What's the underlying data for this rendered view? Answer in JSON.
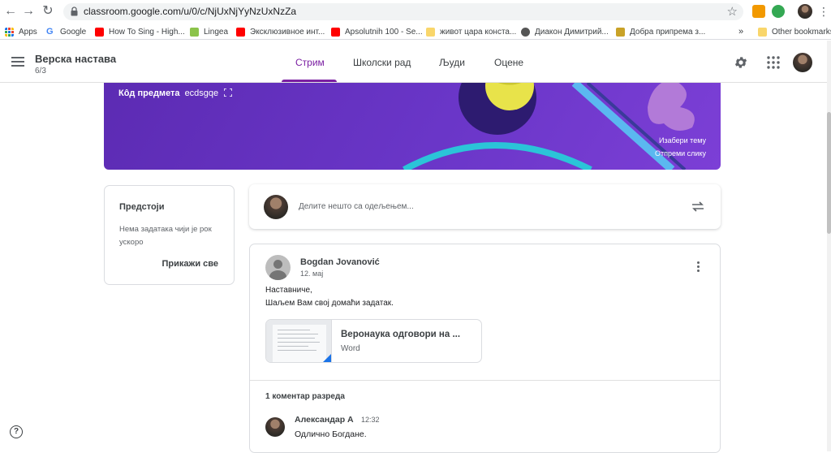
{
  "browser": {
    "url": "classroom.google.com/u/0/c/NjUxNjYyNzUxNzZa",
    "bookmarks": [
      {
        "label": "Apps",
        "icon": "apps-grid-icon"
      },
      {
        "label": "Google",
        "icon": "google-icon"
      },
      {
        "label": "How To Sing - High...",
        "icon": "youtube-icon"
      },
      {
        "label": "Lingea",
        "icon": "lingea-icon"
      },
      {
        "label": "Эксклюзивное инт...",
        "icon": "youtube-icon"
      },
      {
        "label": "Apsolutnih 100 - Se...",
        "icon": "youtube-icon"
      },
      {
        "label": "живот цара конста...",
        "icon": "folder-icon"
      },
      {
        "label": "Диакон Димитрий...",
        "icon": "site-icon"
      },
      {
        "label": "Добра припрема з...",
        "icon": "site-icon"
      }
    ],
    "more_bookmarks": "»",
    "other_bookmarks": "Other bookmarks"
  },
  "classroom": {
    "class_name": "Верска настава",
    "section": "6/3",
    "tabs": [
      {
        "label": "Стрим",
        "active": true
      },
      {
        "label": "Школски рад",
        "active": false
      },
      {
        "label": "Људи",
        "active": false
      },
      {
        "label": "Оцене",
        "active": false
      }
    ],
    "accent": "#7b1fa2"
  },
  "banner": {
    "code_label": "Кôд предмета",
    "code": "ecdsgqe",
    "select_theme": "Изабери тему",
    "upload_photo": "Отпреми слику"
  },
  "upcoming": {
    "title": "Предстоји",
    "empty_text": "Нема задатака чији је рок ускоро",
    "view_all": "Прикажи све"
  },
  "share": {
    "placeholder": "Делите нешто са одељењем..."
  },
  "post": {
    "author": "Bogdan Jovanović",
    "date": "12. мај",
    "body_line1": "Наставниче,",
    "body_line2": "Шаљем Вам свој домаћи задатак.",
    "attachment_title": "Веронаука одговори на ...",
    "attachment_type": "Word",
    "comments_count": "1 коментар разреда",
    "comment": {
      "author": "Александар А",
      "time": "12:32",
      "text": "Одлично Богдане."
    }
  },
  "help": "?"
}
